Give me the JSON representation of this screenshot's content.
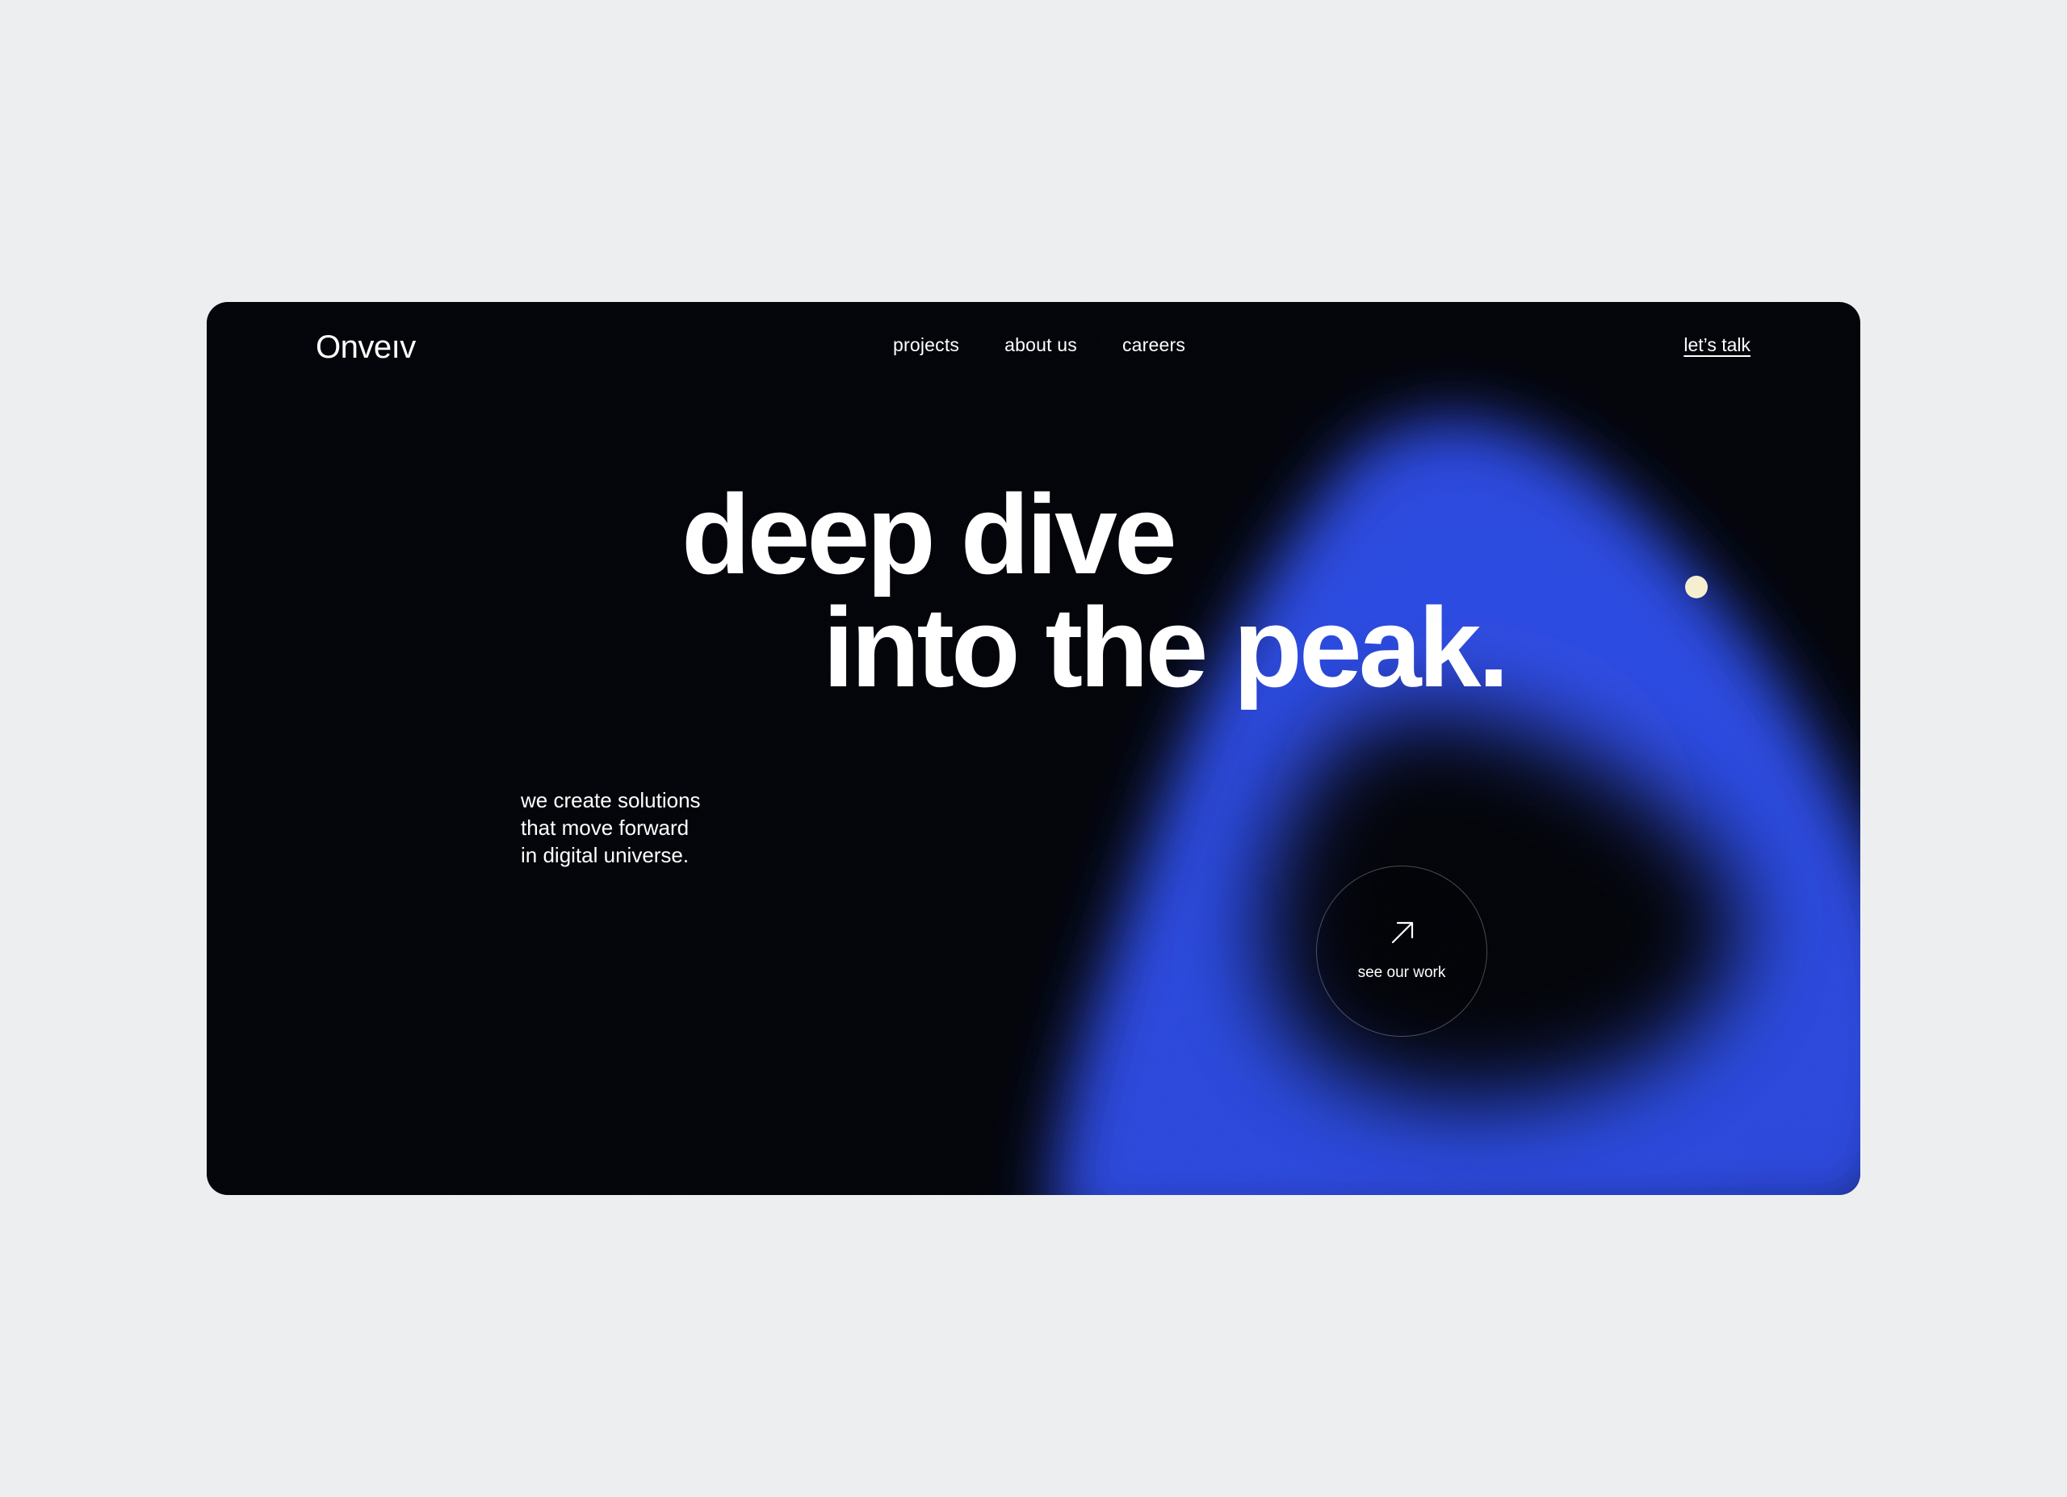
{
  "brand": {
    "logo_text": "Onveıv"
  },
  "nav": {
    "items": [
      {
        "label": "projects"
      },
      {
        "label": "about us"
      },
      {
        "label": "careers"
      }
    ],
    "cta_label": "let’s talk"
  },
  "hero": {
    "line1": "deep dive",
    "line2": "into the peak.",
    "tagline": [
      "we create solutions",
      "that move forward",
      "in digital universe."
    ]
  },
  "work_button": {
    "label": "see our work",
    "icon": "arrow-up-right-icon"
  },
  "colors": {
    "page_background": "#edeef0",
    "frame_background": "#000000",
    "accent_blue": "#2f4fe8",
    "dot": "#f5efcf",
    "text": "#ffffff"
  }
}
